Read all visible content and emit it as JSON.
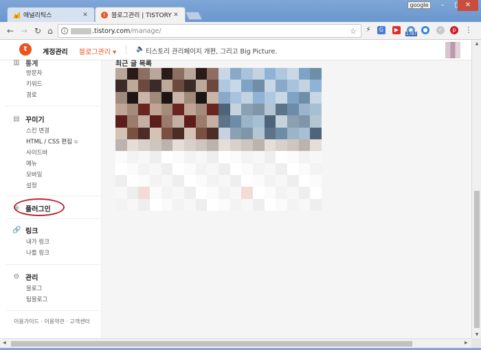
{
  "browser": {
    "tabs": [
      {
        "title": "애널리틱스",
        "active": false,
        "close": "✕"
      },
      {
        "title": "블로그관리 | TISTORY",
        "active": true,
        "close": "✕"
      }
    ],
    "profile_label": "google",
    "window_controls": {
      "minimize": "–",
      "maximize": "□",
      "close": "✕"
    },
    "nav": {
      "back": "←",
      "forward": "→",
      "reload": "↻",
      "home": "⌂"
    },
    "url": {
      "host": ".tistory.com",
      "path": "/manage/"
    },
    "extension_badge": "1787",
    "menu": "⋮"
  },
  "header": {
    "logo": "t",
    "account_label": "계정관리",
    "blog_admin_label": "블로그관리 ▾",
    "notice": "티스토리 관리페이지 개편, 그리고 Big Picture."
  },
  "sidebar": {
    "stats_heading_partial": "통계",
    "stats_items": [
      "방문자",
      "키워드",
      "경로"
    ],
    "decorate": {
      "heading": "꾸미기",
      "items": [
        "스킨 변경",
        "HTML / CSS 편집",
        "사이드바",
        "메뉴",
        "모바일",
        "설정"
      ]
    },
    "plugin": {
      "heading": "플러그인"
    },
    "link": {
      "heading": "링크",
      "items": [
        "내가 링크",
        "나를 링크"
      ]
    },
    "manage": {
      "heading": "관리",
      "items": [
        "블로그",
        "팀블로그"
      ]
    },
    "footer": "이용가이드 · 이용약관 · 고객센터"
  },
  "main": {
    "recent_posts_title": "최근 글 목록"
  },
  "colors": {
    "accent": "#eb531f",
    "highlight": "#c0232f"
  }
}
